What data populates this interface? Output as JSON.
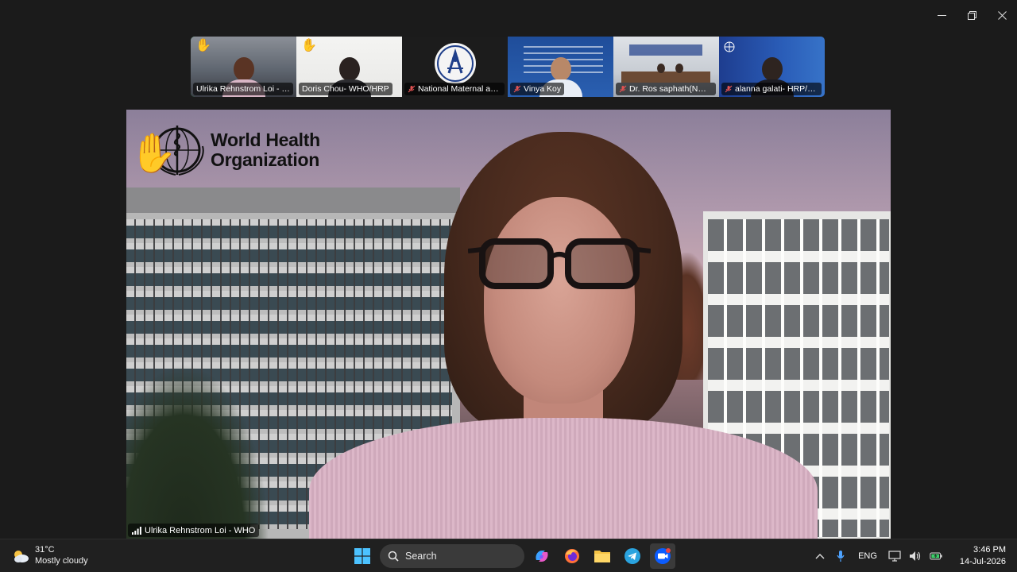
{
  "window": {
    "controls": [
      "minimize",
      "restore",
      "close"
    ]
  },
  "participants": [
    {
      "name": "Ulrika Rehnstrom Loi - W...",
      "hand_raised": true,
      "muted": false,
      "active": true
    },
    {
      "name": "Doris Chou- WHO/HRP",
      "hand_raised": true,
      "muted": false,
      "active": false
    },
    {
      "name": "National Maternal and ...",
      "hand_raised": false,
      "muted": true,
      "active": false
    },
    {
      "name": "Vinya Koy",
      "hand_raised": false,
      "muted": true,
      "active": false
    },
    {
      "name": "Dr. Ros saphath(NMC...",
      "hand_raised": false,
      "muted": true,
      "active": false
    },
    {
      "name": "alanna galati- HRP/W...",
      "hand_raised": false,
      "muted": true,
      "active": false
    }
  ],
  "stage": {
    "logo_line1": "World Health",
    "logo_line2": "Organization",
    "speaker_name": "Ulrika Rehnstrom Loi - WHO",
    "hand_raised": true
  },
  "taskbar": {
    "weather_temp": "31°C",
    "weather_desc": "Mostly cloudy",
    "search_label": "Search",
    "language": "ENG",
    "time": "3:46 PM",
    "date": "14-Jul-2026"
  },
  "colors": {
    "active_outline": "#22c55e",
    "taskbar_bg": "#202020",
    "window_bg": "#1b1b1b"
  }
}
